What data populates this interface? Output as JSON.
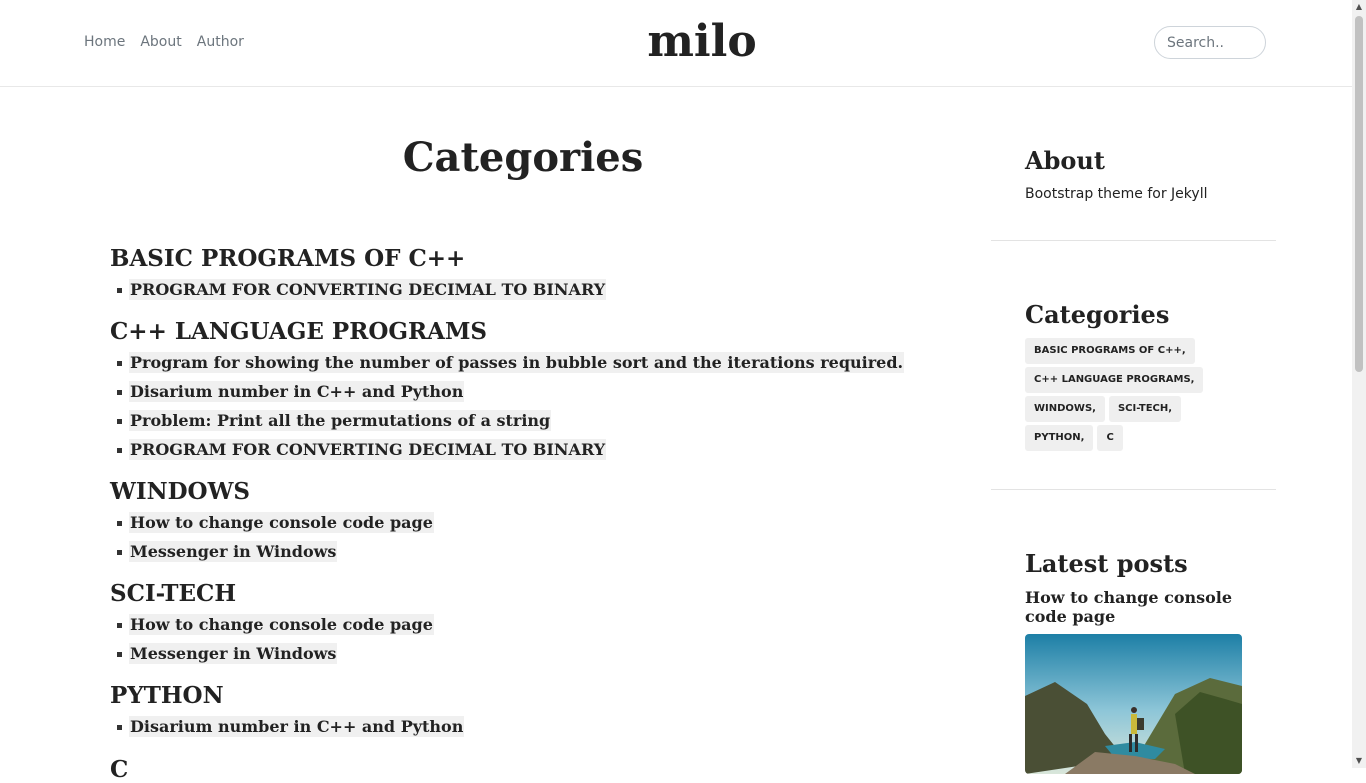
{
  "header": {
    "nav": [
      "Home",
      "About",
      "Author"
    ],
    "logo": "milo",
    "search_placeholder": "Search.."
  },
  "main": {
    "title": "Categories",
    "categories": [
      {
        "name": "BASIC PROGRAMS OF C++",
        "posts": [
          "PROGRAM FOR CONVERTING DECIMAL TO BINARY"
        ]
      },
      {
        "name": "C++ LANGUAGE PROGRAMS",
        "posts": [
          "Program for showing the number of passes in bubble sort and the iterations required.",
          "Disarium number in C++ and Python",
          "Problem: Print all the permutations of a string",
          "PROGRAM FOR CONVERTING DECIMAL TO BINARY"
        ]
      },
      {
        "name": "WINDOWS",
        "posts": [
          "How to change console code page",
          "Messenger in Windows"
        ]
      },
      {
        "name": "SCI-TECH",
        "posts": [
          "How to change console code page",
          "Messenger in Windows"
        ]
      },
      {
        "name": "PYTHON",
        "posts": [
          "Disarium number in C++ and Python"
        ]
      },
      {
        "name": "C",
        "posts": []
      }
    ]
  },
  "sidebar": {
    "about_title": "About",
    "about_text": "Bootstrap theme for Jekyll",
    "categories_title": "Categories",
    "tags": [
      "BASIC PROGRAMS OF C++,",
      "C++ LANGUAGE PROGRAMS,",
      "WINDOWS,",
      "SCI-TECH,",
      "PYTHON,",
      "C"
    ],
    "latest_title": "Latest posts",
    "latest_post_title": "How to change console code page"
  }
}
